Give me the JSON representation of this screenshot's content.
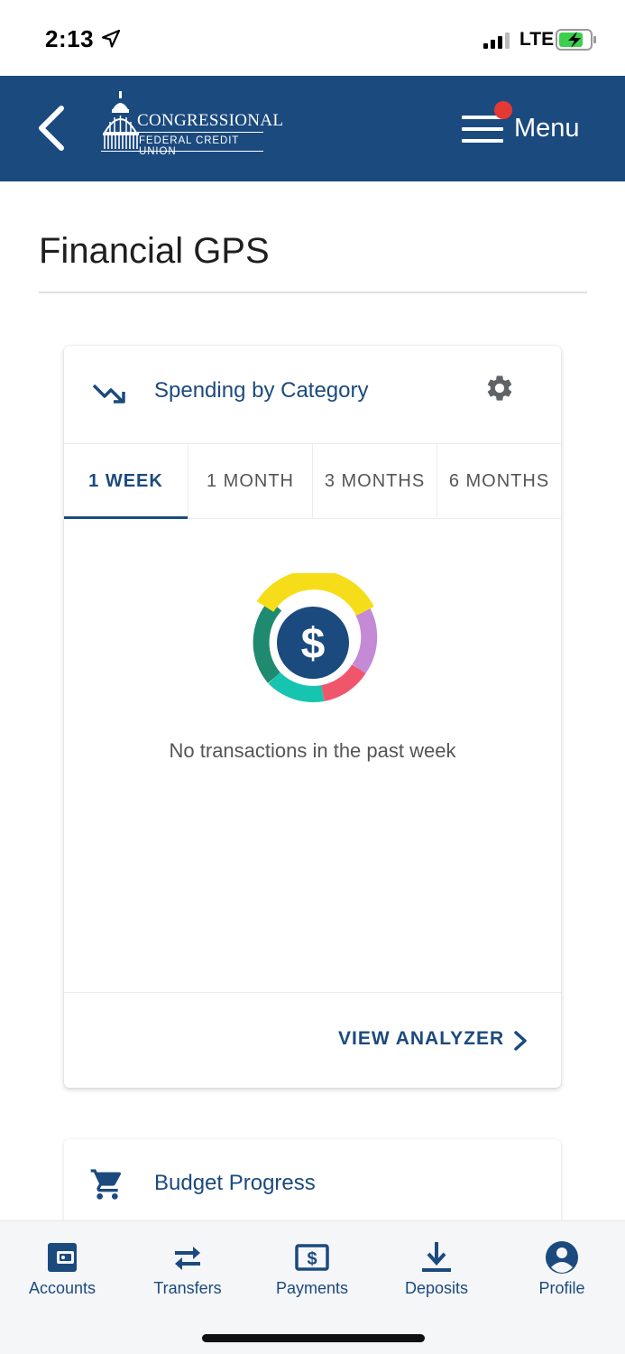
{
  "status_bar": {
    "time": "2:13",
    "network": "LTE"
  },
  "header": {
    "logo_line1": "CONGRESSIONAL",
    "logo_line2": "FEDERAL CREDIT UNION",
    "menu_label": "Menu"
  },
  "page": {
    "title": "Financial GPS"
  },
  "spending_card": {
    "title": "Spending by Category",
    "tabs": [
      {
        "label": "1 WEEK",
        "active": true
      },
      {
        "label": "1 MONTH",
        "active": false
      },
      {
        "label": "3 MONTHS",
        "active": false
      },
      {
        "label": "6 MONTHS",
        "active": false
      }
    ],
    "empty_message": "No transactions in the past week",
    "footer_link": "VIEW ANALYZER"
  },
  "budget_card": {
    "title": "Budget Progress"
  },
  "bottom_nav": [
    {
      "label": "Accounts",
      "icon": "wallet-icon"
    },
    {
      "label": "Transfers",
      "icon": "transfer-arrows-icon"
    },
    {
      "label": "Payments",
      "icon": "dollar-bill-icon"
    },
    {
      "label": "Deposits",
      "icon": "download-icon"
    },
    {
      "label": "Profile",
      "icon": "profile-icon"
    }
  ],
  "colors": {
    "brand": "#1b4a7e",
    "notification_dot": "#e53935",
    "donut_yellow": "#f5de19",
    "donut_purple": "#c48ad6",
    "donut_red": "#f0566b",
    "donut_teal": "#17c4b0",
    "donut_green": "#1f8a70"
  }
}
